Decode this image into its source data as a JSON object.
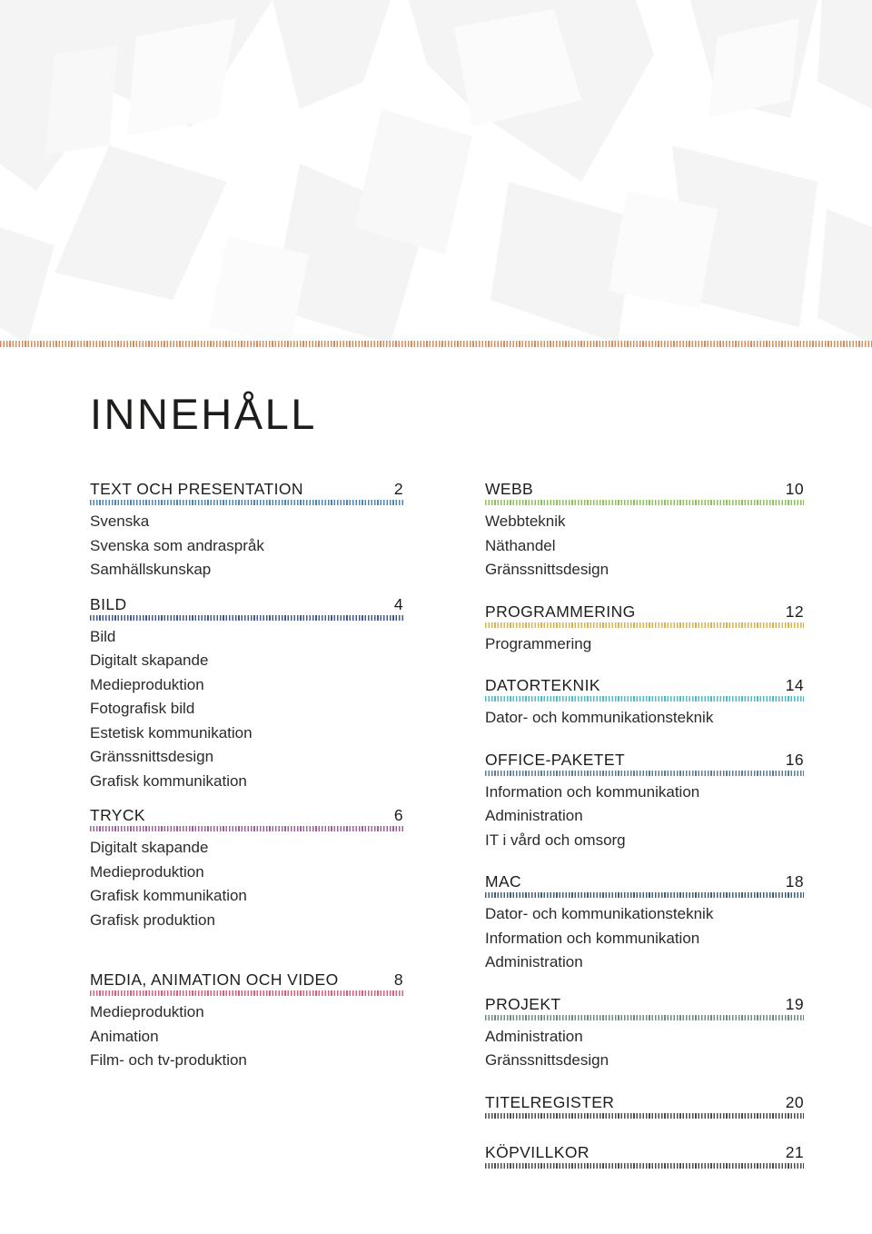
{
  "page": {
    "title": "INNEHÅLL",
    "top_rule_color": "#d98b55",
    "background_color": "#ffffff",
    "text_color": "#1d1d1b"
  },
  "columns": {
    "left": [
      {
        "title": "TEXT OCH PRESENTATION",
        "page": "2",
        "divider_color": "#4a86b8",
        "gap_after": "gap-sm",
        "items": [
          "Svenska",
          "Svenska som andraspråk",
          "Samhällskunskap"
        ]
      },
      {
        "title": "BILD",
        "page": "4",
        "divider_color": "#41588c",
        "gap_after": "gap-sm",
        "items": [
          "Bild",
          "Digitalt skapande",
          "Medieproduktion",
          "Fotografisk bild",
          "Estetisk kommunikation",
          "Gränssnittsdesign",
          "Grafisk kommunikation"
        ]
      },
      {
        "title": "TRYCK",
        "page": "6",
        "divider_color": "#9c5f98",
        "gap_after": "gap-lg",
        "items": [
          "Digitalt skapande",
          "Medieproduktion",
          "Grafisk kommunikation",
          "Grafisk produktion"
        ]
      },
      {
        "title": "MEDIA, ANIMATION OCH VIDEO",
        "page": "8",
        "divider_color": "#d4607a",
        "gap_after": "gap-sm",
        "items": [
          "Medieproduktion",
          "Animation",
          "Film- och tv-produktion"
        ]
      }
    ],
    "right": [
      {
        "title": "WEBB",
        "page": "10",
        "divider_color": "#8cc05a",
        "gap_after": "gap-md",
        "items": [
          "Webbteknik",
          "Näthandel",
          "Gränssnittsdesign"
        ]
      },
      {
        "title": "PROGRAMMERING",
        "page": "12",
        "divider_color": "#d4b24c",
        "gap_after": "gap-md",
        "items": [
          "Programmering"
        ]
      },
      {
        "title": "DATORTEKNIK",
        "page": "14",
        "divider_color": "#4bbcc4",
        "gap_after": "gap-md",
        "items": [
          "Dator- och kommunikationsteknik"
        ]
      },
      {
        "title": "OFFICE-PAKETET",
        "page": "16",
        "divider_color": "#5d7b91",
        "gap_after": "gap-md",
        "items": [
          "Information och kommunikation",
          "Administration",
          "IT i vård och omsorg"
        ]
      },
      {
        "title": "MAC",
        "page": "18",
        "divider_color": "#3e5d75",
        "gap_after": "gap-md",
        "items": [
          "Dator- och kommunikationsteknik",
          "Information och kommunikation",
          "Administration"
        ]
      },
      {
        "title": "PROJEKT",
        "page": "19",
        "divider_color": "#6f8b7d",
        "gap_after": "gap-md",
        "items": [
          "Administration",
          "Gränssnittsdesign"
        ]
      },
      {
        "title": "TITELREGISTER",
        "page": "20",
        "divider_color": "#4a4a48",
        "gap_after": "gap-md",
        "items": []
      },
      {
        "title": "KÖPVILLKOR",
        "page": "21",
        "divider_color": "#4a4a48",
        "gap_after": "gap-md",
        "items": []
      }
    ]
  }
}
